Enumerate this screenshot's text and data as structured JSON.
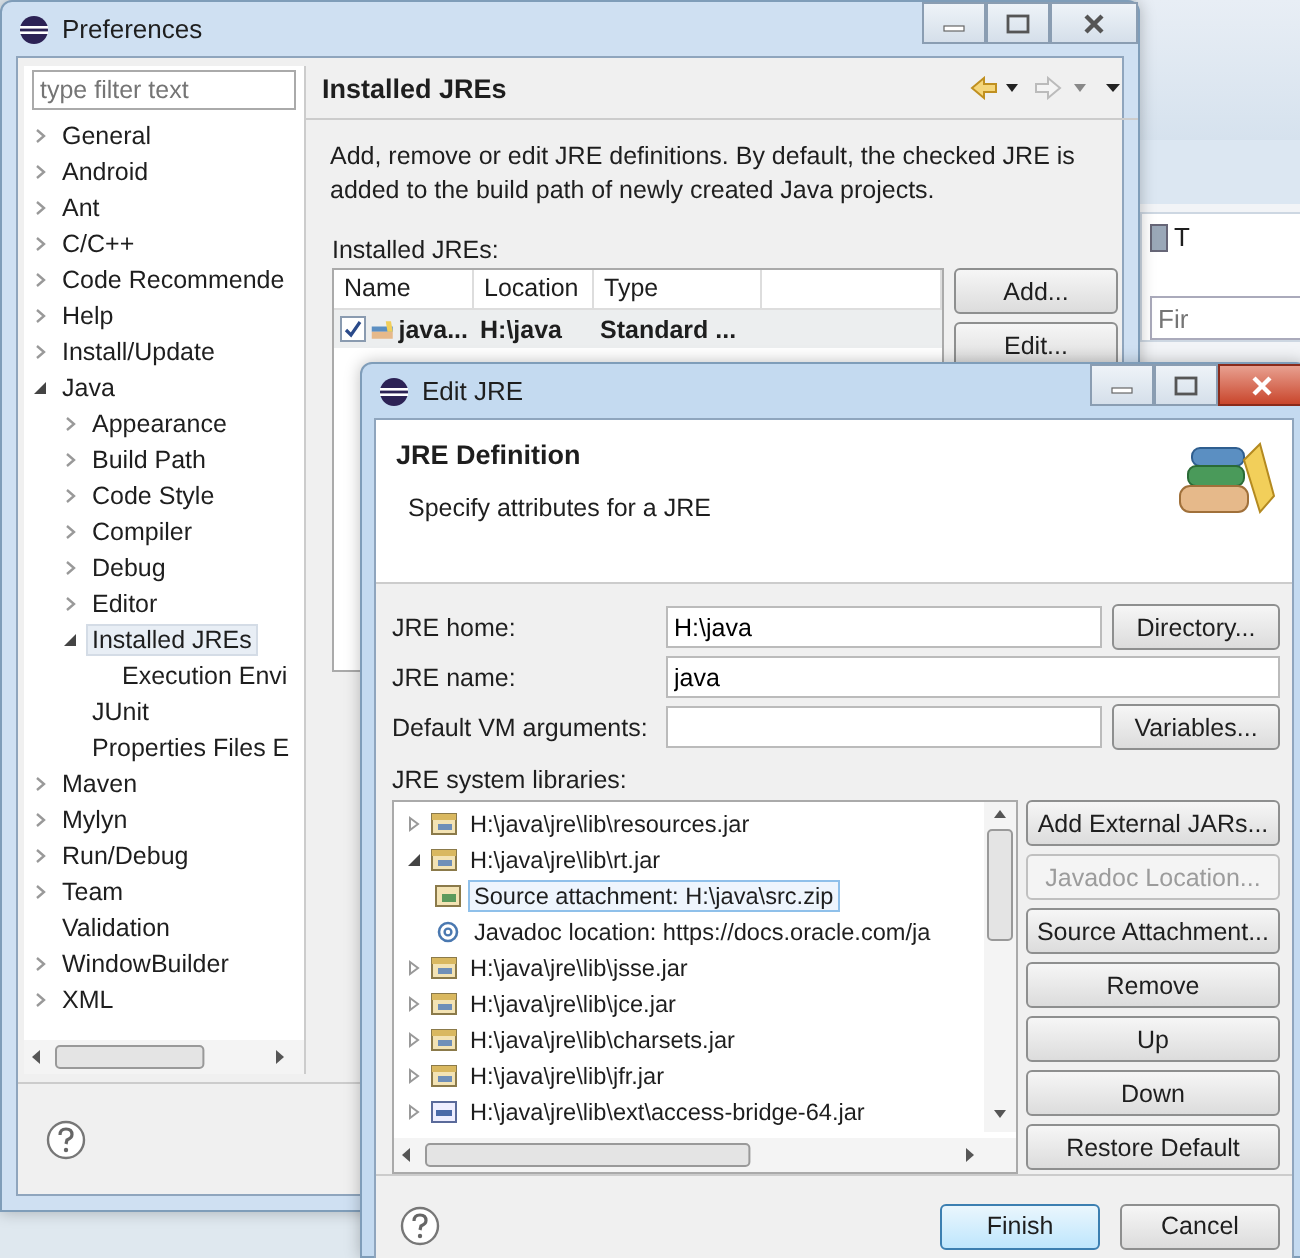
{
  "background_ide": {
    "view_tab": "T",
    "find_field": {
      "placeholder": "Fir"
    }
  },
  "preferences": {
    "title": "Preferences",
    "filter": {
      "placeholder": "type filter text"
    },
    "tree": [
      {
        "label": "General",
        "expanded": false,
        "selected": false
      },
      {
        "label": "Android",
        "expanded": false,
        "selected": false
      },
      {
        "label": "Ant",
        "expanded": false,
        "selected": false
      },
      {
        "label": "C/C++",
        "expanded": false,
        "selected": false
      },
      {
        "label": "Code Recommende",
        "expanded": false,
        "selected": false
      },
      {
        "label": "Help",
        "expanded": false,
        "selected": false
      },
      {
        "label": "Install/Update",
        "expanded": false,
        "selected": false
      },
      {
        "label": "Java",
        "expanded": true,
        "selected": false,
        "children": [
          {
            "label": "Appearance",
            "expanded": false,
            "selected": false
          },
          {
            "label": "Build Path",
            "expanded": false,
            "selected": false
          },
          {
            "label": "Code Style",
            "expanded": false,
            "selected": false
          },
          {
            "label": "Compiler",
            "expanded": false,
            "selected": false
          },
          {
            "label": "Debug",
            "expanded": false,
            "selected": false
          },
          {
            "label": "Editor",
            "expanded": false,
            "selected": false
          },
          {
            "label": "Installed JREs",
            "expanded": true,
            "selected": true,
            "children": [
              {
                "label": "Execution Envi",
                "selected": false
              }
            ]
          },
          {
            "label": "JUnit",
            "selected": false
          },
          {
            "label": "Properties Files E",
            "selected": false
          }
        ]
      },
      {
        "label": "Maven",
        "expanded": false,
        "selected": false
      },
      {
        "label": "Mylyn",
        "expanded": false,
        "selected": false
      },
      {
        "label": "Run/Debug",
        "expanded": false,
        "selected": false
      },
      {
        "label": "Team",
        "expanded": false,
        "selected": false
      },
      {
        "label": "Validation",
        "selected": false
      },
      {
        "label": "WindowBuilder",
        "expanded": false,
        "selected": false
      },
      {
        "label": "XML",
        "expanded": false,
        "selected": false
      }
    ],
    "page": {
      "title": "Installed JREs",
      "description": "Add, remove or edit JRE definitions. By default, the checked JRE is added to the build path of newly created Java projects.",
      "table_label": "Installed JREs:",
      "table": {
        "columns": [
          "Name",
          "Location",
          "Type"
        ],
        "rows": [
          {
            "checked": true,
            "selected": true,
            "default": true,
            "cells": [
              "java...",
              "H:\\java",
              "Standard ..."
            ]
          }
        ]
      },
      "buttons": [
        "Add...",
        "Edit..."
      ]
    }
  },
  "edit_jre": {
    "title": "Edit JRE",
    "header": {
      "title": "JRE Definition",
      "subtitle": "Specify attributes for a JRE"
    },
    "fields": [
      {
        "label": "JRE home:",
        "value": "H:\\java",
        "button": "Directory..."
      },
      {
        "label": "JRE name:",
        "value": "java"
      },
      {
        "label": "Default VM arguments:",
        "button": "Variables..."
      }
    ],
    "libraries_label": "JRE system libraries:",
    "libraries": [
      {
        "label": "H:\\java\\jre\\lib\\resources.jar",
        "kind": "jar",
        "expanded": false,
        "selected": false
      },
      {
        "label": "H:\\java\\jre\\lib\\rt.jar",
        "kind": "jar",
        "expanded": true,
        "selected": false,
        "children": [
          {
            "label": "Source attachment: H:\\java\\src.zip",
            "kind": "source",
            "selected": true
          },
          {
            "label": "Javadoc location: https://docs.oracle.com/ja",
            "kind": "javadoc",
            "selected": false
          }
        ]
      },
      {
        "label": "H:\\java\\jre\\lib\\jsse.jar",
        "kind": "jar",
        "expanded": false,
        "selected": false
      },
      {
        "label": "H:\\java\\jre\\lib\\jce.jar",
        "kind": "jar",
        "expanded": false,
        "selected": false
      },
      {
        "label": "H:\\java\\jre\\lib\\charsets.jar",
        "kind": "jar",
        "expanded": false,
        "selected": false
      },
      {
        "label": "H:\\java\\jre\\lib\\jfr.jar",
        "kind": "jar",
        "expanded": false,
        "selected": false
      },
      {
        "label": "H:\\java\\jre\\lib\\ext\\access-bridge-64.jar",
        "kind": "ext-jar",
        "expanded": false,
        "selected": false
      }
    ],
    "library_buttons": [
      {
        "label": "Add External JARs...",
        "disabled": false
      },
      {
        "label": "Javadoc Location...",
        "disabled": true
      },
      {
        "label": "Source Attachment...",
        "disabled": false
      },
      {
        "label": "Remove",
        "disabled": false
      },
      {
        "label": "Up",
        "disabled": false
      },
      {
        "label": "Down",
        "disabled": false
      },
      {
        "label": "Restore Default",
        "disabled": false
      }
    ],
    "footer_buttons": [
      {
        "label": "Finish",
        "default": true
      },
      {
        "label": "Cancel",
        "default": false
      }
    ]
  }
}
